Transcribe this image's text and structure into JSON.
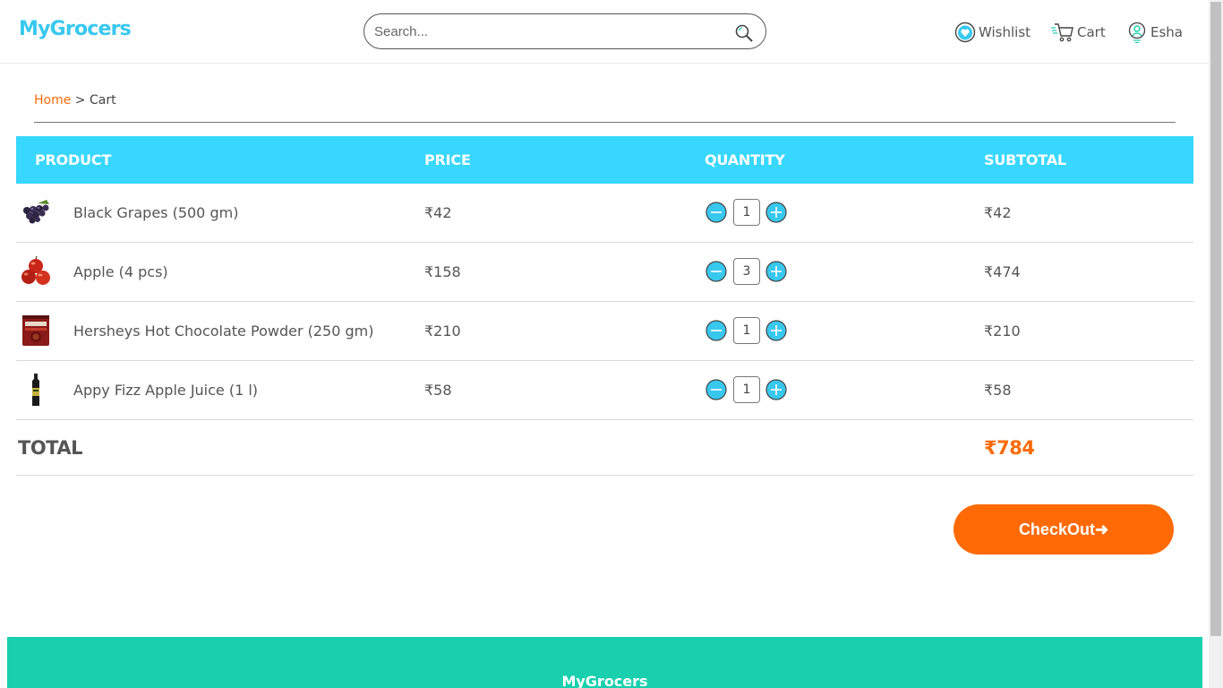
{
  "header": {
    "logo": "MyGrocers",
    "search_placeholder": "Search...",
    "wishlist_label": "Wishlist",
    "cart_label": "Cart",
    "user_label": "Esha"
  },
  "breadcrumb": {
    "home": "Home",
    "separator": " > ",
    "current": "Cart"
  },
  "table": {
    "headers": {
      "product": "PRODUCT",
      "price": "PRICE",
      "quantity": "QUANTITY",
      "subtotal": "SUBTOTAL"
    },
    "rows": [
      {
        "name": "Black Grapes (500 gm)",
        "price": "₹42",
        "qty": "1",
        "subtotal": "₹42",
        "thumb_icon": "grapes-thumbnail"
      },
      {
        "name": "Apple (4 pcs)",
        "price": "₹158",
        "qty": "3",
        "subtotal": "₹474",
        "thumb_icon": "apple-thumbnail"
      },
      {
        "name": "Hersheys Hot Chocolate Powder (250 gm)",
        "price": "₹210",
        "qty": "1",
        "subtotal": "₹210",
        "thumb_icon": "chocolate-tin-thumbnail"
      },
      {
        "name": "Appy Fizz Apple Juice (1 l)",
        "price": "₹58",
        "qty": "1",
        "subtotal": "₹58",
        "thumb_icon": "juice-bottle-thumbnail"
      }
    ],
    "total_label": "TOTAL",
    "total_value": "₹784"
  },
  "checkout_label": "CheckOut➜",
  "footer": {
    "logo": "MyGrocers"
  },
  "colors": {
    "brand": "#38c8ee",
    "table_header": "#38d7fd",
    "accent": "#fa6b06",
    "checkout": "#ff6a06",
    "footer": "#18d0ad"
  }
}
